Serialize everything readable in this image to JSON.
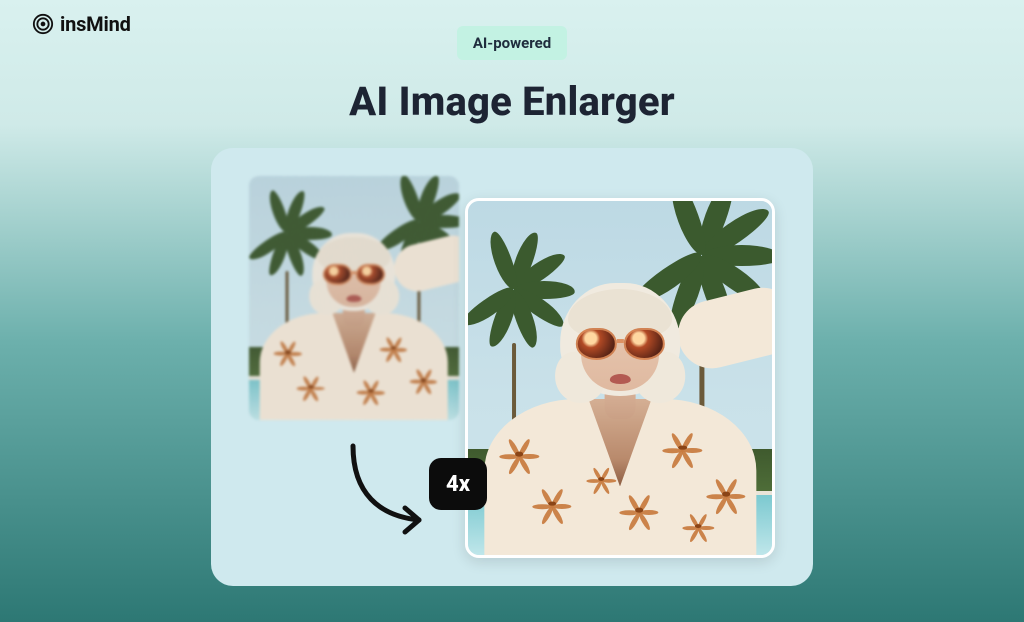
{
  "brand": {
    "name": "insMind"
  },
  "header": {
    "badge": "AI-powered",
    "title": "AI Image Enlarger"
  },
  "demo": {
    "scale_label": "4x",
    "before_alt": "low-resolution blurry photo of a woman with blonde bob, orange sunglasses, floral blouse, palm trees and pool",
    "after_alt": "sharp enlarged photo of the same woman with blonde bob, orange sunglasses, floral blouse, palm trees and pool"
  }
}
